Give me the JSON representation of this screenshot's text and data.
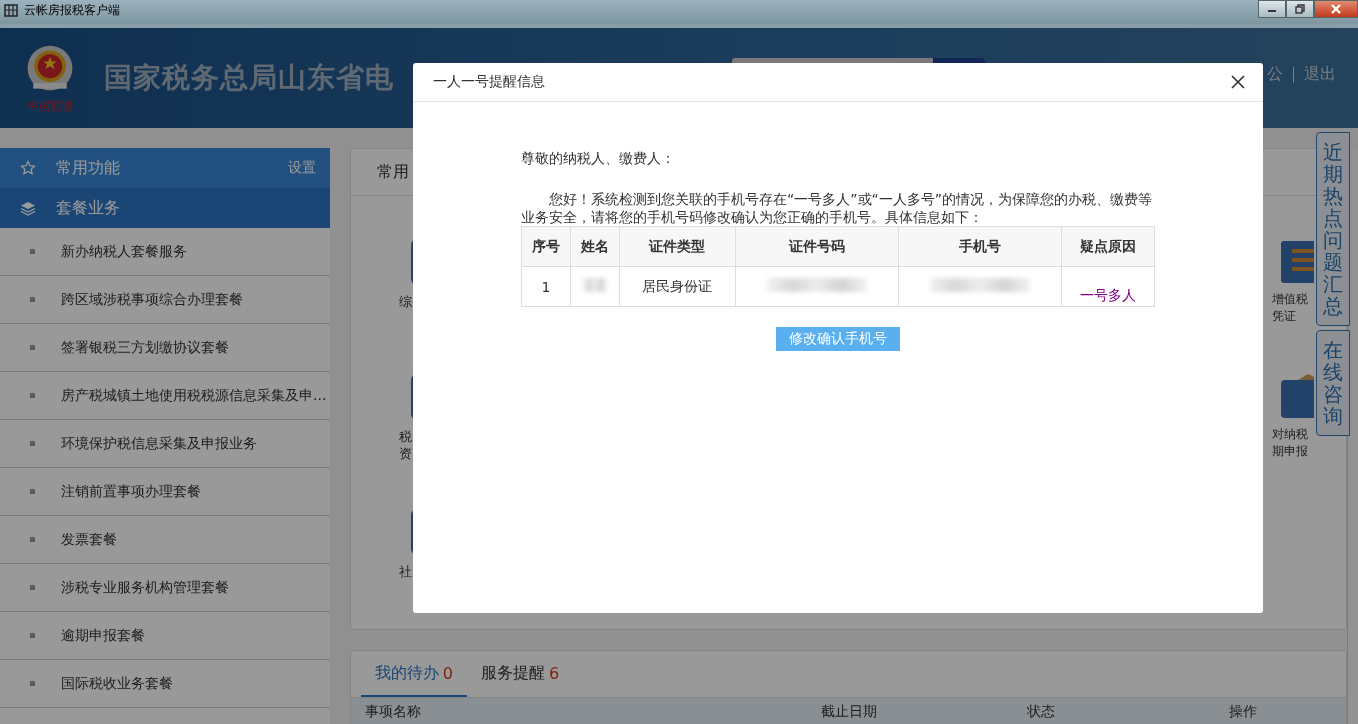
{
  "window": {
    "title": "云帐房报税客户端"
  },
  "header": {
    "logo_caption": "中国税务",
    "site_title": "国家税务总局山东省电",
    "links": [
      "公",
      "退出"
    ]
  },
  "sidebar": {
    "sections": [
      {
        "kind": "favorites",
        "label": "常用功能",
        "action": "设置"
      },
      {
        "kind": "packages",
        "label": "套餐业务"
      }
    ],
    "items": [
      "新办纳税人套餐服务",
      "跨区域涉税事项综合办理套餐",
      "签署银税三方划缴协议套餐",
      "房产税城镇土地使用税税源信息采集及申...",
      "环境保护税信息采集及申报业务",
      "注销前置事项办理套餐",
      "发票套餐",
      "涉税专业服务机构管理套餐",
      "逾期申报套餐",
      "国际税收业务套餐"
    ]
  },
  "main": {
    "heading": "常用",
    "tiles_left": [
      {
        "lines": [
          "综"
        ]
      },
      {
        "lines": [
          "税",
          "资"
        ]
      },
      {
        "lines": [
          "社"
        ]
      }
    ],
    "tiles_right": [
      {
        "kind": "lines",
        "lines": [
          "增值税",
          "凭证"
        ]
      },
      {
        "kind": "box",
        "lines": [
          "对纳税",
          "期申报"
        ]
      }
    ]
  },
  "right_tabs": [
    "近期热点问题汇总",
    "在线咨询"
  ],
  "todo": {
    "tabs": [
      {
        "label": "我的待办",
        "count": "0",
        "selected": true
      },
      {
        "label": "服务提醒",
        "count": "6",
        "selected": false
      }
    ],
    "columns": [
      "事项名称",
      "截止日期",
      "状态",
      "操作"
    ]
  },
  "modal": {
    "title": "一人一号提醒信息",
    "greeting": "尊敬的纳税人、缴费人：",
    "message": "您好！系统检测到您关联的手机号存在“一号多人”或“一人多号”的情况，为保障您的办税、缴费等业务安全，请将您的手机号码修改确认为您正确的手机号。具体信息如下：",
    "columns": [
      "序号",
      "姓名",
      "证件类型",
      "证件号码",
      "手机号",
      "疑点原因"
    ],
    "rows": [
      {
        "index": "1",
        "id_type": "居民身份证",
        "reason": "一号多人"
      }
    ],
    "button": "修改确认手机号"
  }
}
